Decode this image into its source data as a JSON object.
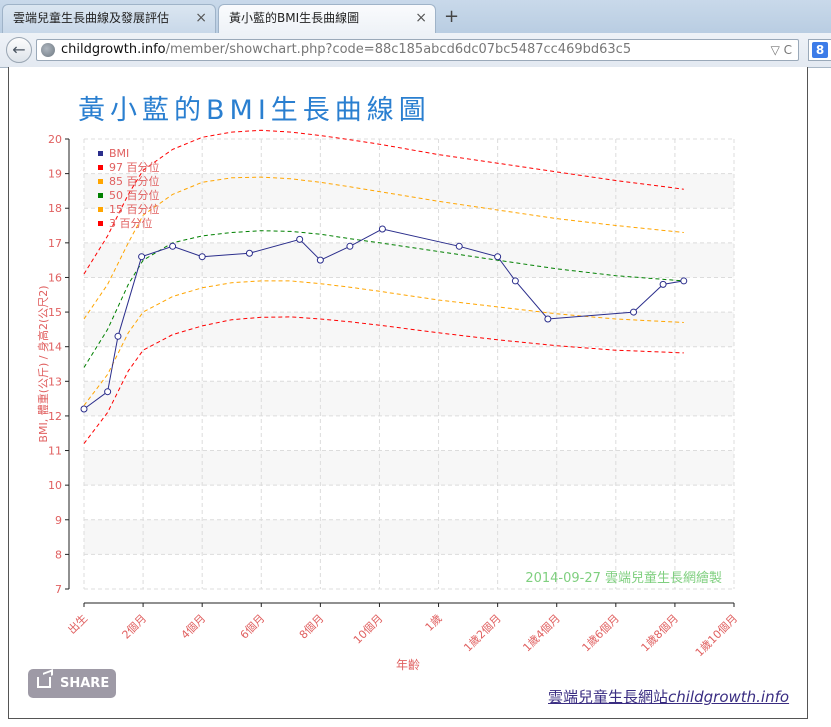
{
  "browser": {
    "tabs": [
      {
        "title": "雲端兒童生長曲線及發展評估",
        "active": false
      },
      {
        "title": "黃小藍的BMI生長曲線圖",
        "active": true
      }
    ],
    "new_tab_label": "+",
    "close_glyph": "×",
    "url_host": "childgrowth.info",
    "url_path": "/member/showchart.php?code=88c185abcd6dc07bc5487cc469bd63c5",
    "url_tools": "▽ C",
    "search_engine_glyph": "8"
  },
  "page": {
    "share_label": "SHARE",
    "site_link_cn": "雲端兒童生長網站",
    "site_link_en": "childgrowth.info"
  },
  "colors": {
    "title": "#2a7fd0",
    "axis_text": "#e06060",
    "bmi": "#2b2e8c",
    "p97": "#ff0000",
    "p85": "#ffa500",
    "p50": "#008000",
    "p15": "#ffa500",
    "p3": "#ff0000",
    "watermark": "#7fcf7f"
  },
  "chart_data": {
    "type": "line",
    "title": "黃小藍的BMI生長曲線圖",
    "xlabel": "年齡",
    "ylabel": "BMI, 體重(公斤) / 身高2(公尺2)",
    "ylim": [
      7,
      20
    ],
    "xlim": [
      0,
      22
    ],
    "yticks": [
      7,
      8,
      9,
      10,
      11,
      12,
      13,
      14,
      15,
      16,
      17,
      18,
      19,
      20
    ],
    "xticks": [
      {
        "x": 0,
        "label": "出生"
      },
      {
        "x": 2,
        "label": "2個月"
      },
      {
        "x": 4,
        "label": "4個月"
      },
      {
        "x": 6,
        "label": "6個月"
      },
      {
        "x": 8,
        "label": "8個月"
      },
      {
        "x": 10,
        "label": "10個月"
      },
      {
        "x": 12,
        "label": "1歲"
      },
      {
        "x": 14,
        "label": "1歲2個月"
      },
      {
        "x": 16,
        "label": "1歲4個月"
      },
      {
        "x": 18,
        "label": "1歲6個月"
      },
      {
        "x": 20,
        "label": "1歲8個月"
      },
      {
        "x": 22,
        "label": "1歲10個月"
      }
    ],
    "grid": true,
    "legend_position": "top-left",
    "watermark": "2014-09-27 雲端兒童生長網繪製",
    "series": [
      {
        "name": "BMI",
        "x": [
          0,
          0.8,
          1.15,
          1.95,
          3.0,
          4.0,
          5.6,
          7.3,
          8.0,
          9.0,
          10.1,
          12.7,
          14.0,
          14.6,
          15.7,
          18.6,
          19.6,
          20.3
        ],
        "values": [
          12.2,
          12.7,
          14.3,
          16.6,
          16.9,
          16.6,
          16.7,
          17.1,
          16.5,
          16.9,
          17.4,
          16.9,
          16.6,
          15.9,
          14.8,
          15.0,
          15.8,
          15.9
        ]
      },
      {
        "name": "97 百分位",
        "x": [
          0,
          0.8,
          1.5,
          2,
          3,
          4,
          5,
          6,
          7,
          8,
          9,
          10,
          12,
          14,
          16,
          18,
          20.3
        ],
        "values": [
          16.1,
          17.2,
          18.4,
          19.1,
          19.7,
          20.05,
          20.2,
          20.25,
          20.2,
          20.1,
          19.98,
          19.85,
          19.55,
          19.3,
          19.05,
          18.8,
          18.55
        ]
      },
      {
        "name": "85 百分位",
        "x": [
          0,
          0.8,
          1.5,
          2,
          3,
          4,
          5,
          6,
          7,
          8,
          9,
          10,
          12,
          14,
          16,
          18,
          20.3
        ],
        "values": [
          14.8,
          15.8,
          17.0,
          17.8,
          18.4,
          18.75,
          18.88,
          18.9,
          18.85,
          18.75,
          18.62,
          18.48,
          18.2,
          17.95,
          17.7,
          17.5,
          17.3
        ]
      },
      {
        "name": "50 百分位",
        "x": [
          0,
          0.8,
          1.5,
          2,
          3,
          4,
          5,
          6,
          7,
          8,
          9,
          10,
          12,
          14,
          16,
          18,
          20.3
        ],
        "values": [
          13.4,
          14.5,
          15.8,
          16.5,
          17.0,
          17.2,
          17.3,
          17.35,
          17.33,
          17.25,
          17.12,
          17.0,
          16.75,
          16.5,
          16.25,
          16.05,
          15.9
        ]
      },
      {
        "name": "15 百分位",
        "x": [
          0,
          0.8,
          1.5,
          2,
          3,
          4,
          5,
          6,
          7,
          8,
          9,
          10,
          12,
          14,
          16,
          18,
          20.3
        ],
        "values": [
          12.3,
          13.2,
          14.4,
          15.0,
          15.45,
          15.7,
          15.85,
          15.9,
          15.9,
          15.82,
          15.72,
          15.6,
          15.35,
          15.15,
          14.95,
          14.8,
          14.7
        ]
      },
      {
        "name": "3 百分位",
        "x": [
          0,
          0.8,
          1.5,
          2,
          3,
          4,
          5,
          6,
          7,
          8,
          9,
          10,
          12,
          14,
          16,
          18,
          20.3
        ],
        "values": [
          11.2,
          12.1,
          13.3,
          13.9,
          14.35,
          14.6,
          14.78,
          14.85,
          14.86,
          14.8,
          14.72,
          14.62,
          14.4,
          14.2,
          14.03,
          13.9,
          13.82
        ]
      }
    ]
  }
}
